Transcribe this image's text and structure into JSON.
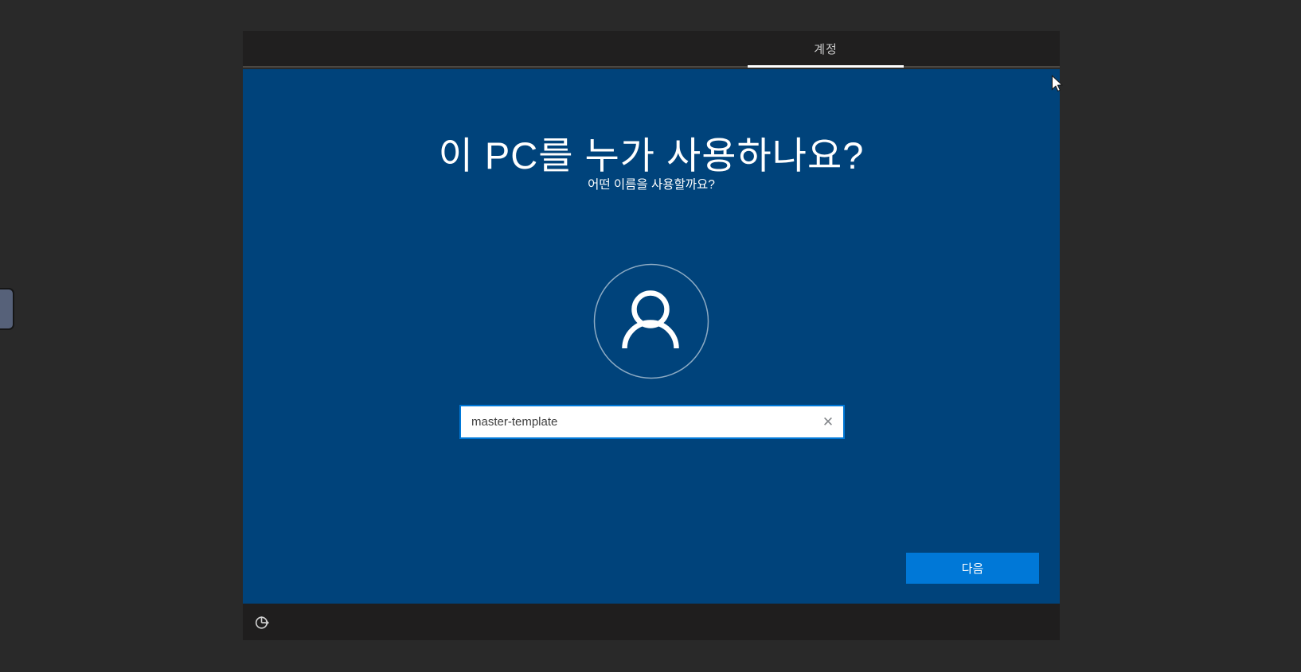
{
  "header": {
    "tab_label": "계정"
  },
  "main": {
    "title": "이 PC를 누가 사용하나요?",
    "subtitle": "어떤 이름을 사용할까요?",
    "avatar_icon": "user-icon",
    "name_input": {
      "value": "master-template",
      "clear_icon": "✕"
    },
    "next_button_label": "다음"
  },
  "footer": {
    "ease_of_access_icon": "ease-of-access-icon"
  },
  "colors": {
    "accent": "#0078d7",
    "panel_blue": "#00437b",
    "bar_dark": "#201f1f",
    "desktop_background": "#292929",
    "tab_indicator": "#ffffff"
  }
}
